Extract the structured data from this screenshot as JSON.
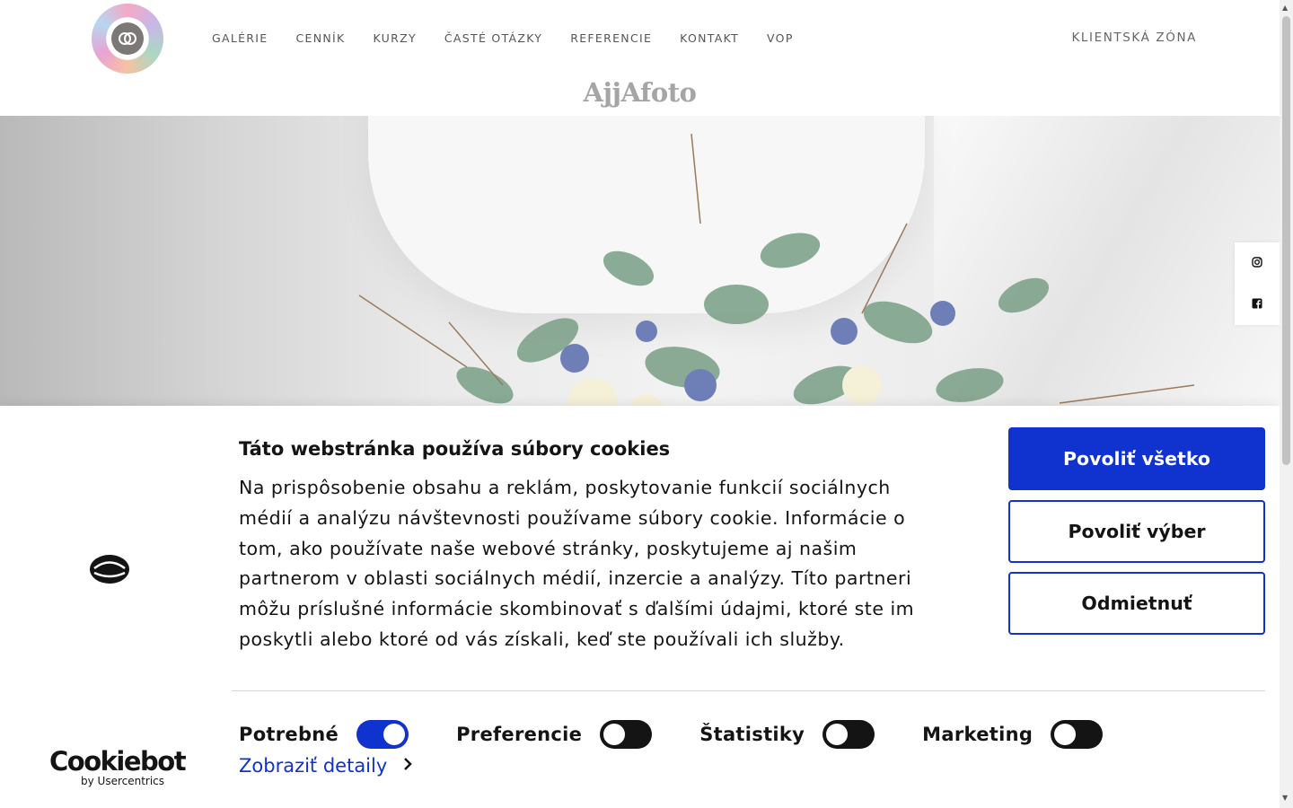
{
  "header": {
    "nav": [
      "GALÉRIE",
      "CENNÍK",
      "KURZY",
      "ČASTÉ OTÁZKY",
      "REFERENCIE",
      "KONTAKT",
      "VOP"
    ],
    "client_zone": "KLIENTSKÁ ZÓNA",
    "brand": "AjjAfoto"
  },
  "social": {
    "icons": [
      "instagram-icon",
      "facebook-icon"
    ]
  },
  "cookie": {
    "title": "Táto webstránka používa súbory cookies",
    "text": "Na prispôsobenie obsahu a reklám, poskytovanie funkcií sociálnych médií a analýzu návštevnosti používame súbory cookie. Informácie o tom, ako používate naše webové stránky, poskytujeme aj našim partnerom v oblasti sociálnych médií, inzercie a analýzy. Títo partneri môžu príslušné informácie skombinovať s ďalšími údajmi, ktoré ste im poskytli alebo ktoré od vás získali, keď ste používali ich služby.",
    "allow_all": "Povoliť všetko",
    "allow_selection": "Povoliť výber",
    "deny": "Odmietnuť",
    "toggles": [
      {
        "label": "Potrebné",
        "on": true
      },
      {
        "label": "Preferencie",
        "on": false
      },
      {
        "label": "Štatistiky",
        "on": false
      },
      {
        "label": "Marketing",
        "on": false
      }
    ],
    "details": "Zobraziť detaily",
    "brand_name": "Cookiebot",
    "brand_by": "by Usercentrics"
  },
  "colors": {
    "accent": "#1032cf",
    "text": "#141414"
  }
}
